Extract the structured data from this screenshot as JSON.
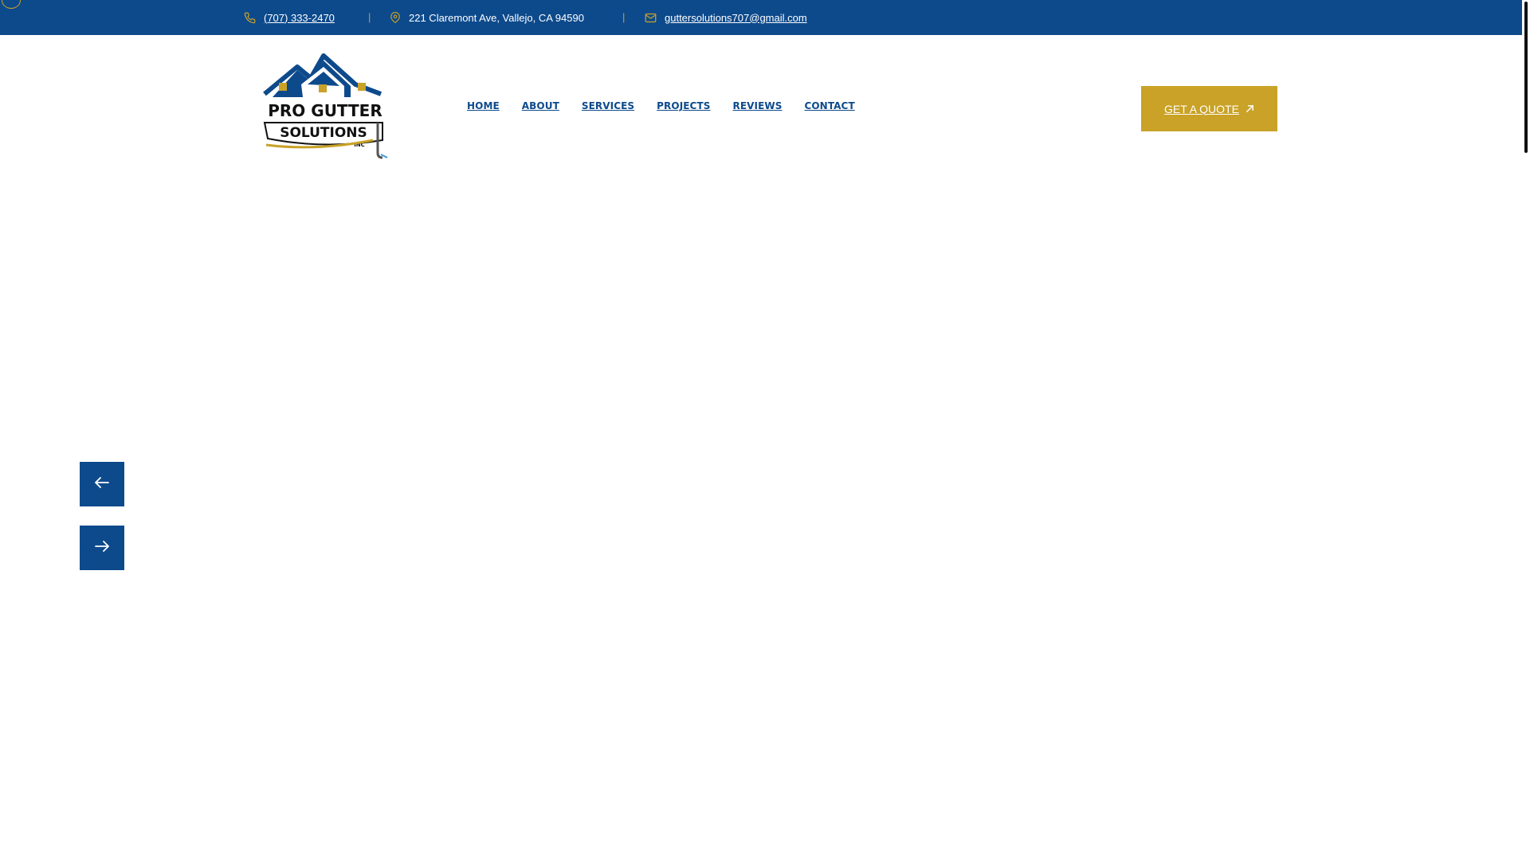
{
  "topbar": {
    "phone": "(707) 333-2470",
    "address": "221 Claremont Ave, Vallejo, CA 94590",
    "email": "guttersolutions707@gmail.com",
    "separator": "|"
  },
  "logo": {
    "line1": "PRO GUTTER",
    "line2": "SOLUTIONS",
    "line3": "INC"
  },
  "nav": {
    "items": [
      "HOME",
      "ABOUT",
      "SERVICES",
      "PROJECTS",
      "REVIEWS",
      "CONTACT"
    ]
  },
  "cta": {
    "label": "GET A QUOTE"
  },
  "slider": {
    "prev_icon": "arrow-left-icon",
    "next_icon": "arrow-right-icon"
  },
  "colors": {
    "brand_blue": "#0d4a8c",
    "brand_gold": "#c9a227"
  }
}
